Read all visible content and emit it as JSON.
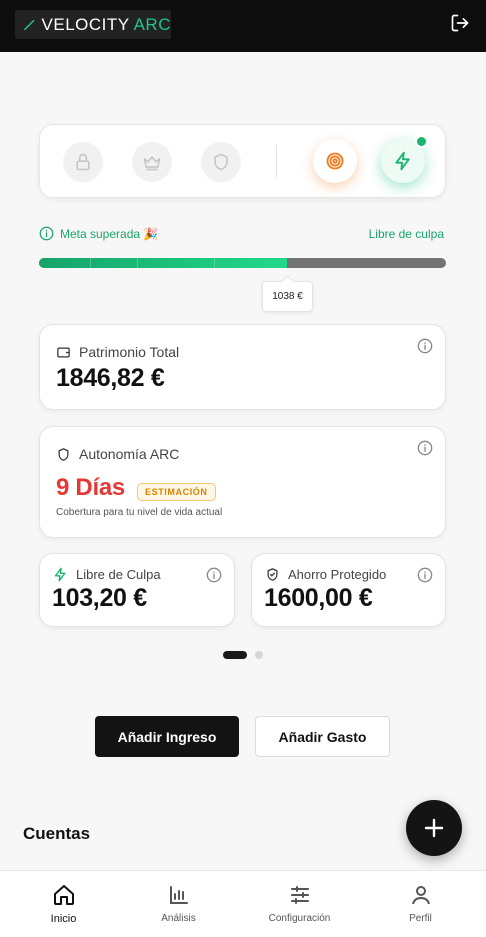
{
  "header": {
    "brand_main": "VELOCITY",
    "brand_accent": "ARC",
    "logout_icon": "logout-icon"
  },
  "badges": [
    {
      "icon": "lock-icon",
      "active": false
    },
    {
      "icon": "crown-icon",
      "active": false
    },
    {
      "icon": "shield-icon",
      "active": false
    },
    {
      "icon": "target-icon",
      "active": true,
      "color": "#f07a1a"
    },
    {
      "icon": "bolt-icon",
      "active": true,
      "color": "#18b56e",
      "notification": true
    }
  ],
  "progress": {
    "left_label": "Meta superada 🎉",
    "right_label": "Libre de culpa",
    "fill_fraction": 0.61,
    "tooltip": "1038 €"
  },
  "cards": {
    "patrimonio": {
      "label": "Patrimonio Total",
      "value": "1846,82 €"
    },
    "autonomia": {
      "label": "Autonomía ARC",
      "value": "9 Días",
      "badge": "ESTIMACIÓN",
      "subtitle": "Cobertura para tu nivel de vida actual"
    },
    "culpa": {
      "label": "Libre de Culpa",
      "value": "103,20 €"
    },
    "ahorro": {
      "label": "Ahorro Protegido",
      "value": "1600,00 €"
    }
  },
  "pager": {
    "pages": 2,
    "current": 1
  },
  "actions": {
    "add_income": "Añadir Ingreso",
    "add_expense": "Añadir Gasto"
  },
  "accounts": {
    "title": "Cuentas"
  },
  "nav": [
    {
      "label": "Inicio",
      "icon": "home-icon",
      "active": true
    },
    {
      "label": "Análisis",
      "icon": "bar-chart-icon",
      "active": false
    },
    {
      "label": "Configuración",
      "icon": "sliders-icon",
      "active": false
    },
    {
      "label": "Perfil",
      "icon": "user-icon",
      "active": false
    }
  ],
  "colors": {
    "accent": "#23c489",
    "danger": "#e53935",
    "warning": "#d98500",
    "dark": "#131313"
  }
}
